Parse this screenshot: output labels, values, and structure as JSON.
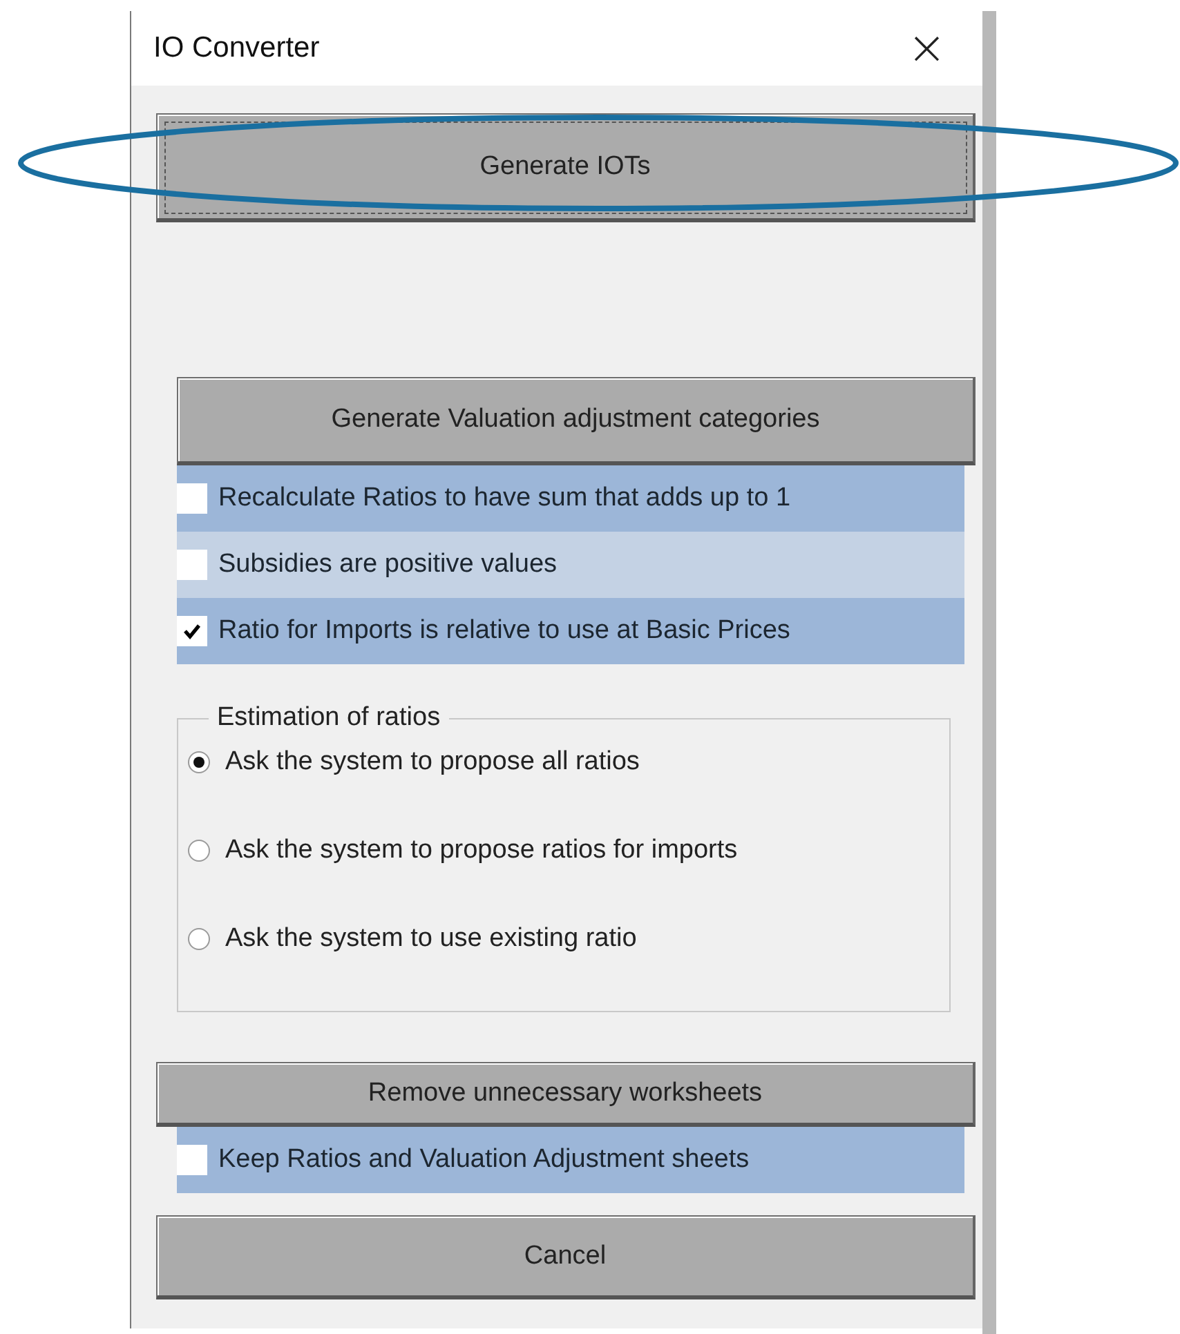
{
  "window": {
    "title": "IO Converter",
    "close": "×"
  },
  "generate_button": {
    "label": "Generate IOTs",
    "focused": true
  },
  "valuation_button": {
    "label": "Generate Valuation adjustment categories"
  },
  "valuation_options": [
    {
      "label": "Recalculate Ratios to have sum that adds up to 1",
      "checked": false
    },
    {
      "label": "Subsidies are positive values",
      "checked": false
    },
    {
      "label": "Ratio for Imports is relative to use at Basic Prices",
      "checked": true
    }
  ],
  "estimation_group": {
    "title": "Estimation of ratios",
    "options": [
      {
        "label": "Ask the system to propose all ratios",
        "selected": true
      },
      {
        "label": "Ask the system to propose ratios for imports",
        "selected": false
      },
      {
        "label": "Ask the system to use existing ratio",
        "selected": false
      }
    ]
  },
  "remove_button": {
    "label": "Remove unnecessary worksheets"
  },
  "remove_options": [
    {
      "label": "Keep Ratios and Valuation Adjustment sheets",
      "checked": false
    }
  ],
  "cancel_button": {
    "label": "Cancel"
  }
}
